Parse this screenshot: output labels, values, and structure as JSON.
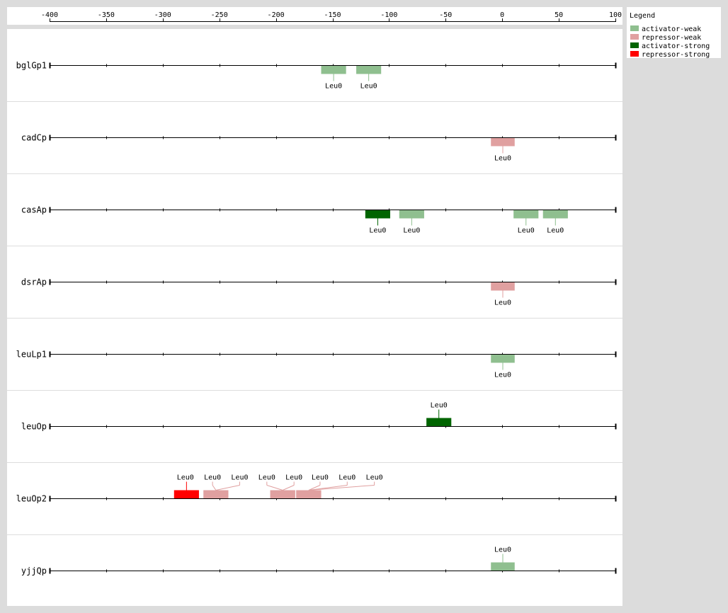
{
  "axis": {
    "min": -400,
    "max": 100,
    "ticks": [
      -400,
      -350,
      -300,
      -250,
      -200,
      -150,
      -100,
      -50,
      0,
      50,
      100
    ],
    "tick_labels": [
      "-400",
      "-350",
      "-300",
      "-250",
      "-200",
      "-150",
      "-100",
      "-50",
      "0",
      "50",
      "100"
    ]
  },
  "legend": {
    "title": "Legend",
    "items": [
      {
        "label": "activator-weak",
        "color": "#8fbf8f"
      },
      {
        "label": "repressor-weak",
        "color": "#e0a0a0"
      },
      {
        "label": "activator-strong",
        "color": "#006400"
      },
      {
        "label": "repressor-strong",
        "color": "#ff0000"
      }
    ]
  },
  "rows": [
    {
      "name": "bglGp1",
      "sites": [
        {
          "label": "Leu0",
          "start": -160,
          "end": -138,
          "type": "activator-weak",
          "side": "below"
        },
        {
          "label": "Leu0",
          "start": -129,
          "end": -107,
          "type": "activator-weak",
          "side": "below"
        }
      ]
    },
    {
      "name": "cadCp",
      "sites": [
        {
          "label": "Leu0",
          "start": -10,
          "end": 11,
          "type": "repressor-weak",
          "side": "below"
        }
      ]
    },
    {
      "name": "casAp",
      "sites": [
        {
          "label": "Leu0",
          "start": -121,
          "end": -99,
          "type": "activator-strong",
          "side": "below"
        },
        {
          "label": "Leu0",
          "start": -91,
          "end": -69,
          "type": "activator-weak",
          "side": "below"
        },
        {
          "label": "Leu0",
          "start": 10,
          "end": 32,
          "type": "activator-weak",
          "side": "below"
        },
        {
          "label": "Leu0",
          "start": 36,
          "end": 58,
          "type": "activator-weak",
          "side": "below"
        }
      ]
    },
    {
      "name": "dsrAp",
      "sites": [
        {
          "label": "Leu0",
          "start": -10,
          "end": 11,
          "type": "repressor-weak",
          "side": "below"
        }
      ]
    },
    {
      "name": "leuLp1",
      "sites": [
        {
          "label": "Leu0",
          "start": -10,
          "end": 11,
          "type": "activator-weak",
          "side": "below"
        }
      ]
    },
    {
      "name": "leuOp",
      "sites": [
        {
          "label": "Leu0",
          "start": -67,
          "end": -45,
          "type": "activator-strong",
          "side": "above"
        }
      ]
    },
    {
      "name": "leuOp2",
      "sites": [
        {
          "label": "Leu0",
          "start": -290,
          "end": -268,
          "type": "repressor-strong",
          "side": "above",
          "label_at": -280
        },
        {
          "label": "Leu0",
          "start": -264,
          "end": -242,
          "type": "repressor-weak",
          "side": "above",
          "label_at": -256
        },
        {
          "label": "Leu0",
          "start": -264,
          "end": -242,
          "type": "repressor-weak",
          "side": "above",
          "label_at": -232
        },
        {
          "label": "Leu0",
          "start": -205,
          "end": -183,
          "type": "repressor-weak",
          "side": "above",
          "label_at": -208
        },
        {
          "label": "Leu0",
          "start": -205,
          "end": -183,
          "type": "repressor-weak",
          "side": "above",
          "label_at": -184
        },
        {
          "label": "Leu0",
          "start": -182,
          "end": -160,
          "type": "repressor-weak",
          "side": "above",
          "label_at": -161
        },
        {
          "label": "Leu0",
          "start": -182,
          "end": -160,
          "type": "repressor-weak",
          "side": "above",
          "label_at": -137
        },
        {
          "label": "Leu0",
          "start": -182,
          "end": -160,
          "type": "repressor-weak",
          "side": "above",
          "label_at": -113
        }
      ]
    },
    {
      "name": "yjjQp",
      "sites": [
        {
          "label": "Leu0",
          "start": -10,
          "end": 11,
          "type": "activator-weak",
          "side": "above"
        }
      ]
    }
  ]
}
